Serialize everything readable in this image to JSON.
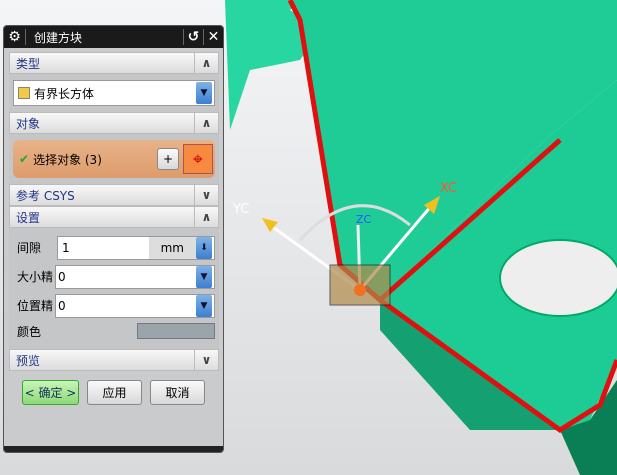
{
  "dialog": {
    "title": "创建方块",
    "reset_icon": "↺",
    "close_icon": "✕"
  },
  "sections": {
    "type": {
      "label": "类型",
      "value": "有界长方体"
    },
    "object": {
      "label": "对象",
      "select": "选择对象 (3)"
    },
    "csys": {
      "label": "参考 CSYS"
    },
    "settings": {
      "label": "设置",
      "gap_label": "间隙",
      "gap_value": "1",
      "gap_unit": "mm",
      "size_label": "大小精",
      "size_value": "0",
      "pos_label": "位置精",
      "pos_value": "0",
      "color_label": "颜色",
      "color_value": "#9aa4ab"
    },
    "preview": {
      "label": "预览"
    }
  },
  "buttons": {
    "ok": "< 确定 >",
    "apply": "应用",
    "cancel": "取消"
  },
  "viewport": {
    "yc": "YC",
    "xc": "XC",
    "zc": "ZC"
  }
}
